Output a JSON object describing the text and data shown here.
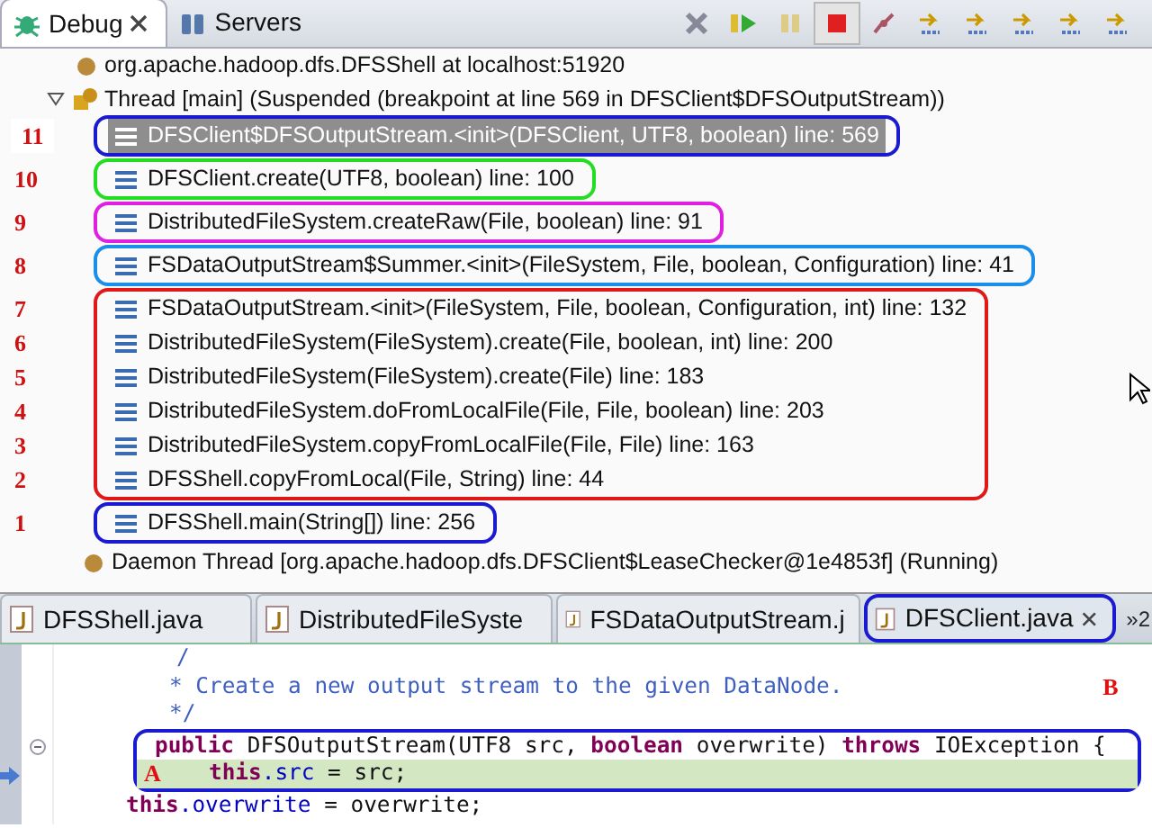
{
  "debug_view": {
    "tabs": [
      {
        "label": "Debug",
        "selected": true,
        "closable": true
      },
      {
        "label": "Servers",
        "selected": false,
        "closable": false
      }
    ],
    "toolbar": [
      {
        "kind": "remove",
        "pressed": false
      },
      {
        "kind": "resume",
        "pressed": false
      },
      {
        "kind": "suspend",
        "pressed": false
      },
      {
        "kind": "terminate",
        "pressed": true
      },
      {
        "kind": "disconnect",
        "pressed": false
      },
      {
        "kind": "step",
        "pressed": false
      },
      {
        "kind": "step",
        "pressed": false
      },
      {
        "kind": "step",
        "pressed": false
      },
      {
        "kind": "step",
        "pressed": false
      },
      {
        "kind": "step",
        "pressed": false
      }
    ],
    "process": "org.apache.hadoop.dfs.DFSShell at localhost:51920",
    "thread": {
      "label": "Thread [main] (Suspended (breakpoint at line 569 in DFSClient$DFSOutputStream))",
      "expanded": true
    },
    "frame_groups": [
      {
        "color": "#1a1ad0",
        "frames": [
          {
            "number": "11",
            "label": "DFSClient$DFSOutputStream.<init>(DFSClient, UTF8, boolean) line: 569",
            "selected": true
          }
        ]
      },
      {
        "color": "#22dd22",
        "frames": [
          {
            "number": "10",
            "label": "DFSClient.create(UTF8, boolean) line: 100",
            "selected": false
          }
        ]
      },
      {
        "color": "#e020e0",
        "frames": [
          {
            "number": "9",
            "label": "DistributedFileSystem.createRaw(File, boolean) line: 91",
            "selected": false
          }
        ]
      },
      {
        "color": "#1a8ee8",
        "frames": [
          {
            "number": "8",
            "label": "FSDataOutputStream$Summer.<init>(FileSystem, File, boolean, Configuration) line: 41",
            "selected": false
          }
        ]
      },
      {
        "color": "#e01818",
        "frames": [
          {
            "number": "7",
            "label": "FSDataOutputStream.<init>(FileSystem, File, boolean, Configuration, int) line: 132",
            "selected": false
          },
          {
            "number": "6",
            "label": "DistributedFileSystem(FileSystem).create(File, boolean, int) line: 200",
            "selected": false
          },
          {
            "number": "5",
            "label": "DistributedFileSystem(FileSystem).create(File) line: 183",
            "selected": false
          },
          {
            "number": "4",
            "label": "DistributedFileSystem.doFromLocalFile(File, File, boolean) line: 203",
            "selected": false
          },
          {
            "number": "3",
            "label": "DistributedFileSystem.copyFromLocalFile(File, File) line: 163",
            "selected": false
          },
          {
            "number": "2",
            "label": "DFSShell.copyFromLocal(File, String) line: 44",
            "selected": false
          }
        ]
      },
      {
        "color": "#1a1ad0",
        "frames": [
          {
            "number": "1",
            "label": "DFSShell.main(String[]) line: 256",
            "selected": false
          }
        ]
      }
    ],
    "daemon": "Daemon Thread [org.apache.hadoop.dfs.DFSClient$LeaseChecker@1e4853f] (Running)"
  },
  "editor": {
    "tabs": [
      {
        "label": "DFSShell.java",
        "selected": false,
        "closable": false
      },
      {
        "label": "DistributedFileSyste",
        "selected": false,
        "closable": false
      },
      {
        "label": "FSDataOutputStream.j",
        "selected": false,
        "closable": false
      },
      {
        "label": "DFSClient.java",
        "selected": true,
        "closable": true
      }
    ],
    "overflow": "»2",
    "blocks": [
      {
        "kind": "plain",
        "lines": [
          {
            "kind": "comment_open",
            "current": false,
            "tokens": [
              {
                "text": "/",
                "kind": "comment"
              }
            ]
          },
          {
            "kind": "comment",
            "current": false,
            "tokens": [
              {
                "text": "* Create a new output stream to the given DataNode.",
                "kind": "comment"
              }
            ],
            "note_right": "B"
          },
          {
            "kind": "comment",
            "current": false,
            "tokens": [
              {
                "text": "*/",
                "kind": "comment"
              }
            ]
          }
        ]
      },
      {
        "kind": "outlined",
        "lines": [
          {
            "kind": "signature",
            "current": false,
            "foldable": true,
            "tokens": [
              {
                "text": "public",
                "kind": "keyword"
              },
              {
                "text": " DFSOutputStream(UTF8 src, ",
                "kind": "plain"
              },
              {
                "text": "boolean",
                "kind": "keyword"
              },
              {
                "text": " overwrite) ",
                "kind": "plain"
              },
              {
                "text": "throws",
                "kind": "keyword"
              },
              {
                "text": " IOException {",
                "kind": "plain"
              }
            ]
          },
          {
            "kind": "statement",
            "current": true,
            "note_left": "A",
            "tokens": [
              {
                "text": "this",
                "kind": "keyword"
              },
              {
                "text": ".src",
                "kind": "field"
              },
              {
                "text": " = src;",
                "kind": "plain"
              }
            ]
          }
        ]
      },
      {
        "kind": "plain",
        "lines": [
          {
            "kind": "statement",
            "current": false,
            "tokens": [
              {
                "text": "this",
                "kind": "keyword"
              },
              {
                "text": ".overwrite",
                "kind": "field"
              },
              {
                "text": " = overwrite;",
                "kind": "plain"
              }
            ]
          }
        ]
      }
    ]
  }
}
